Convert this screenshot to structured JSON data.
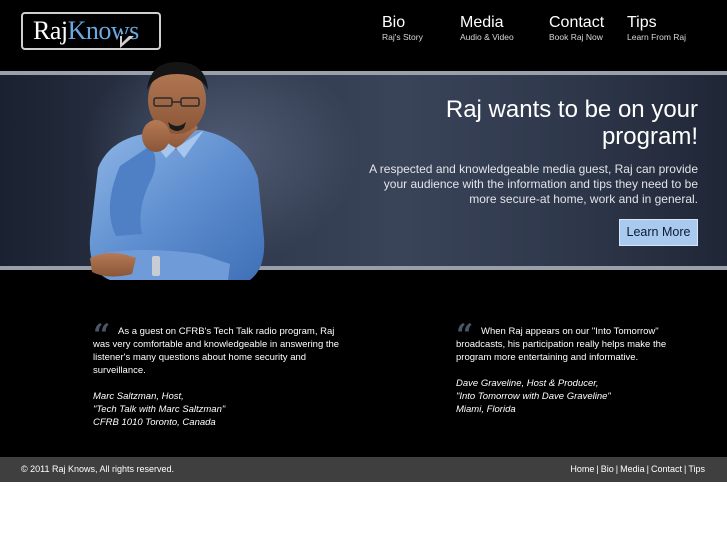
{
  "brand": {
    "logo_part1": "Raj",
    "logo_part2": "Knows"
  },
  "nav": {
    "bio": {
      "title": "Bio",
      "sub": "Raj's Story"
    },
    "media": {
      "title": "Media",
      "sub": "Audio & Video"
    },
    "contact": {
      "title": "Contact",
      "sub": "Book Raj Now"
    },
    "tips": {
      "title": "Tips",
      "sub": "Learn From Raj"
    }
  },
  "hero": {
    "title": "Raj wants to be on your program!",
    "text": "A respected and knowledgeable media guest, Raj can provide your audience with the information and tips they need to be more secure-at home, work and in general.",
    "button": "Learn More"
  },
  "testimonials": [
    {
      "mark": "“",
      "body": "As a guest on CFRB's Tech Talk radio program, Raj was very comfortable and knowledgeable in answering the listener's many questions about home security and surveillance.",
      "sig1": "Marc Saltzman, Host,",
      "sig2": "\"Tech Talk with Marc Saltzman\"",
      "sig3": "CFRB 1010 Toronto, Canada"
    },
    {
      "mark": "“",
      "body": "When Raj appears on our \"Into Tomorrow\" broadcasts, his participation really helps make the program more entertaining and informative.",
      "sig1": "Dave Graveline, Host & Producer,",
      "sig2": "\"Into Tomorrow with Dave Graveline\"",
      "sig3": "Miami, Florida"
    }
  ],
  "footer": {
    "copyright": "© 2011 Raj Knows, All rights reserved.",
    "links": [
      "Home",
      "Bio",
      "Media",
      "Contact",
      "Tips"
    ],
    "separator": "|"
  },
  "colors": {
    "accent": "#6aa8e0",
    "button": "#a9c9ef",
    "footer": "#3f3f3f"
  }
}
